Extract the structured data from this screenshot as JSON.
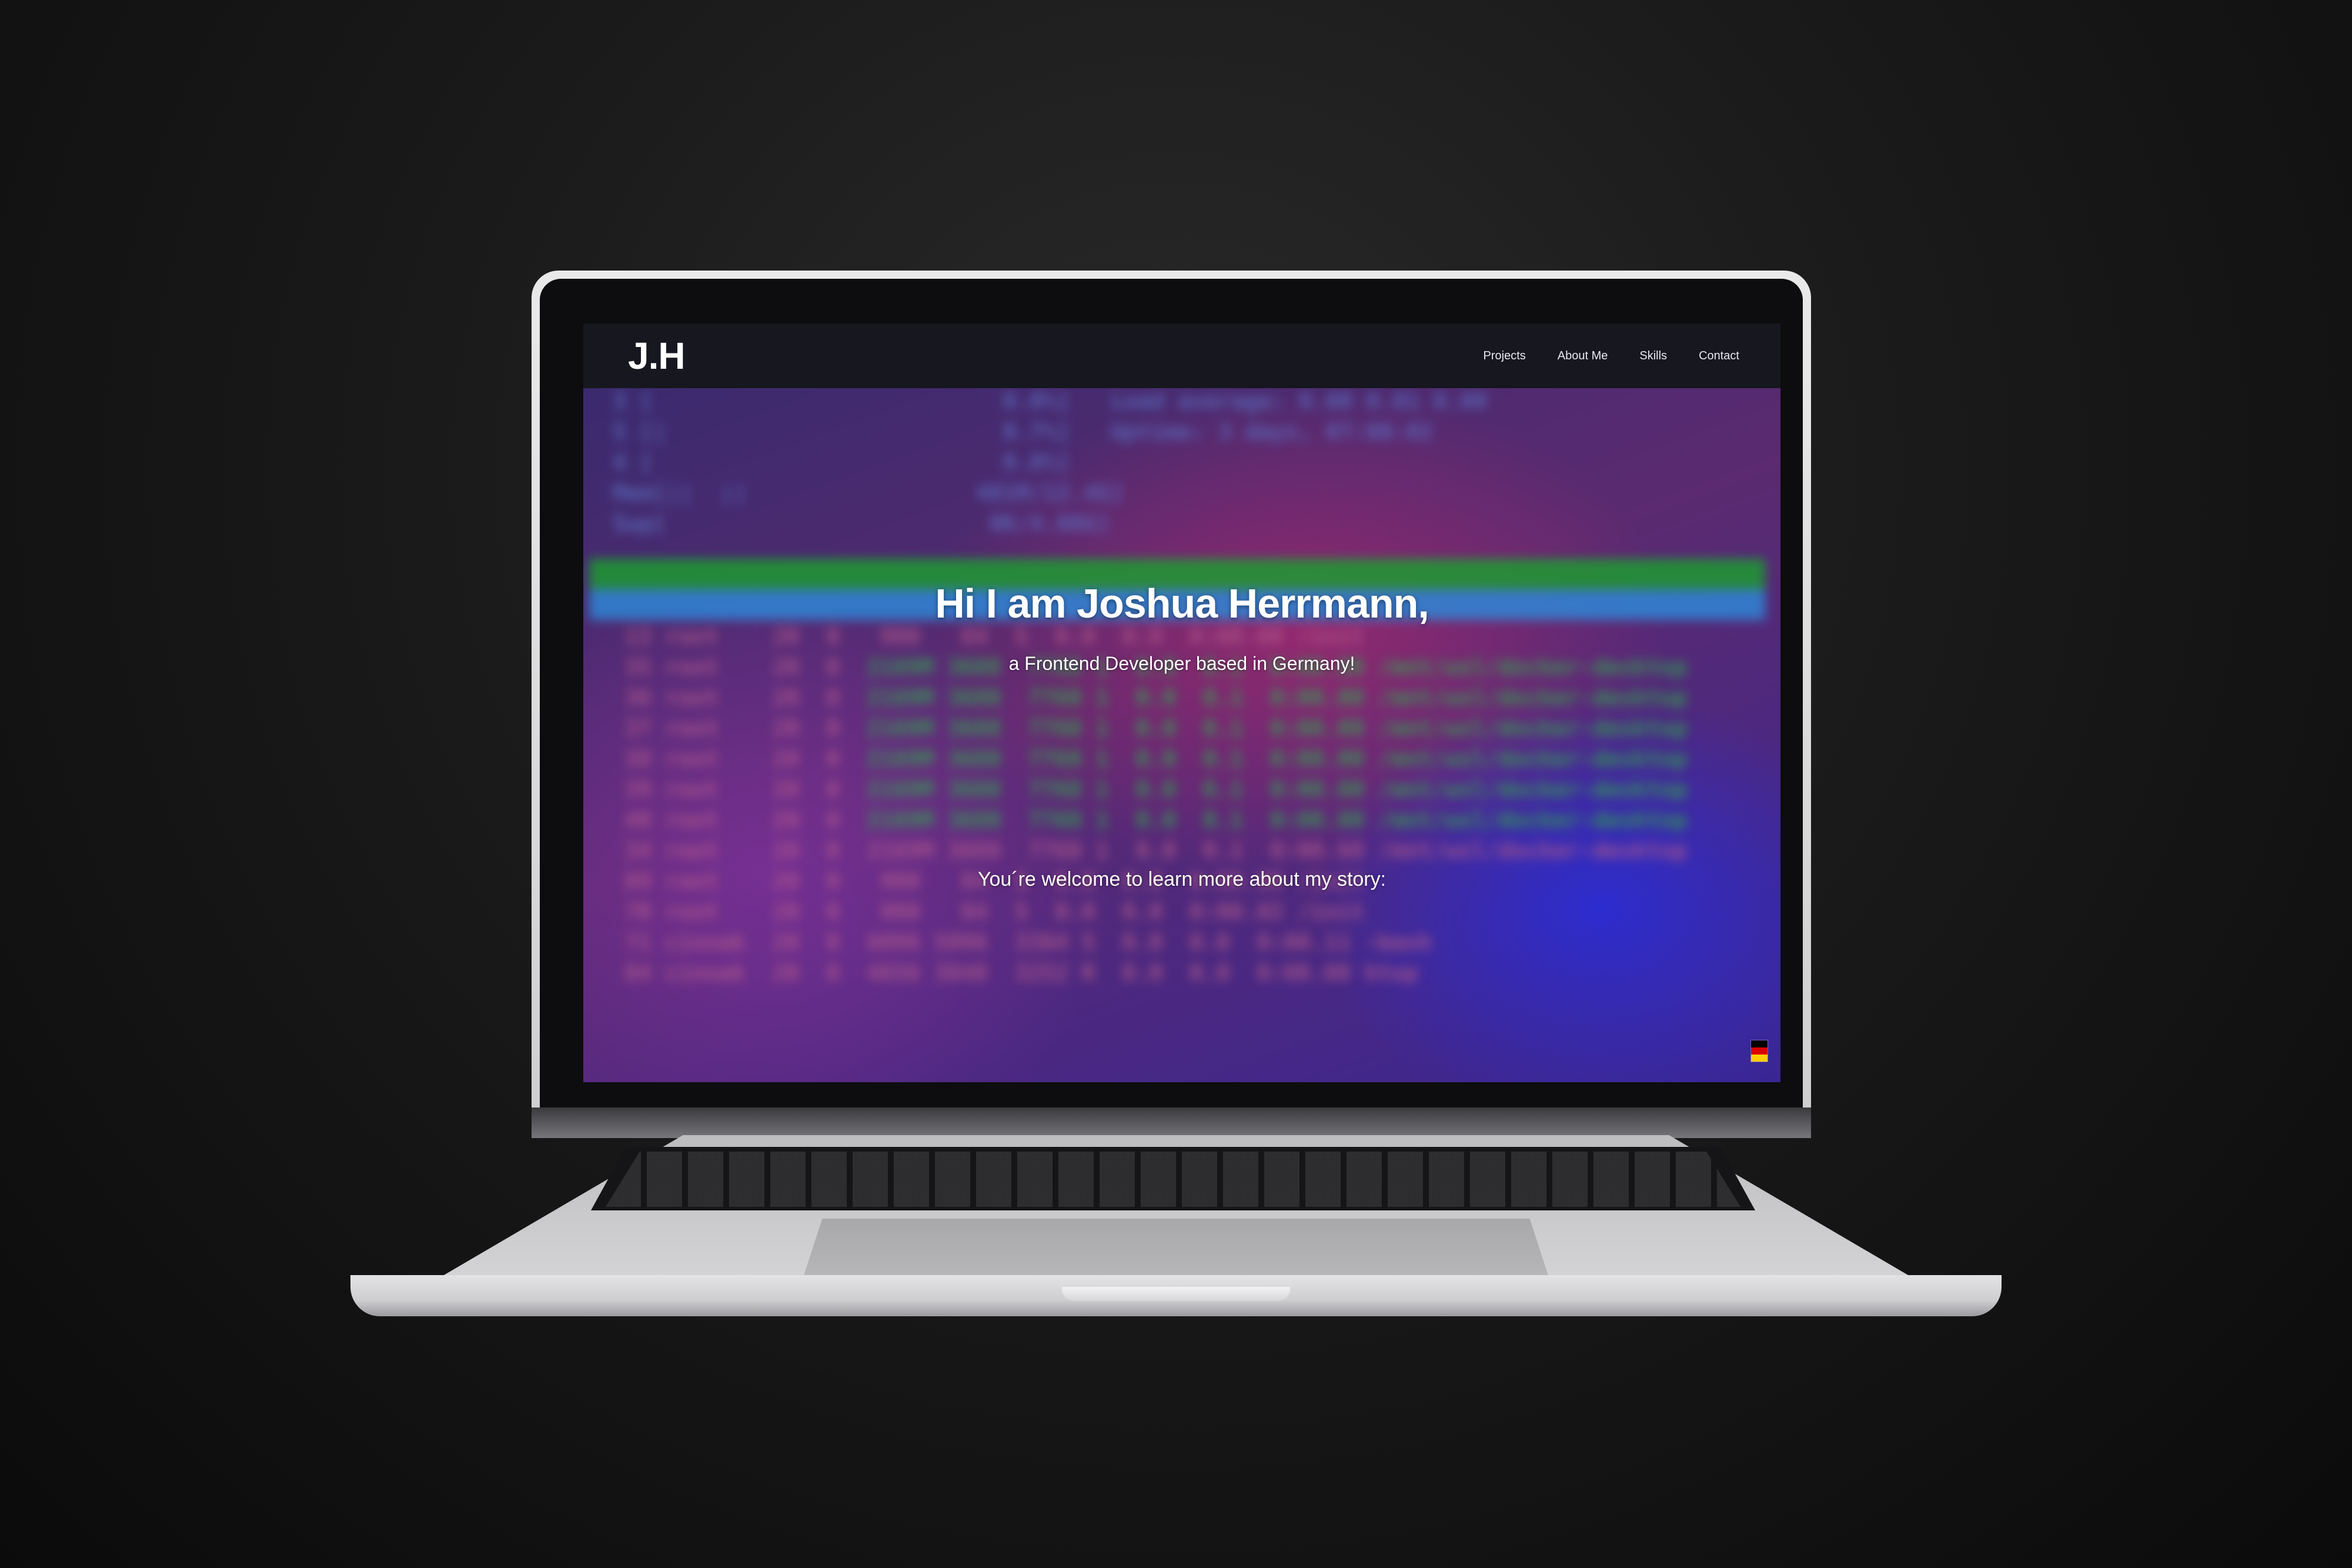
{
  "site": {
    "logo": "J.H",
    "nav": [
      "Projects",
      "About Me",
      "Skills",
      "Contact"
    ],
    "hero": {
      "title": "Hi I am Joshua Herrmann,",
      "subtitle": "a Frontend Developer based in Germany!",
      "cta": "You´re welcome to learn more about my story:"
    },
    "language_flag": "germany-flag-icon"
  },
  "colors": {
    "navbar": "#17171f",
    "hero_text": "#ffffff",
    "background_purple": "#3b2a6e",
    "terminal_green": "#1e9a32",
    "terminal_blue": "#2f86d6"
  }
}
